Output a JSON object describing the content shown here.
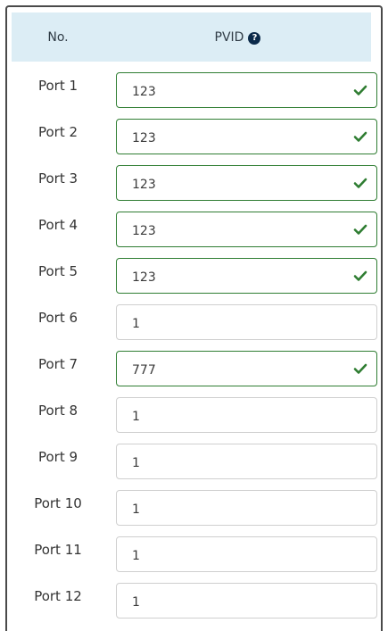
{
  "header": {
    "no_label": "No.",
    "pvid_label": "PVID"
  },
  "colors": {
    "valid_border": "#2f7d32",
    "check": "#2f7d32",
    "header_bg": "#dcedf5"
  },
  "ports": [
    {
      "label": "Port 1",
      "value": "123",
      "valid": true
    },
    {
      "label": "Port 2",
      "value": "123",
      "valid": true
    },
    {
      "label": "Port 3",
      "value": "123",
      "valid": true
    },
    {
      "label": "Port 4",
      "value": "123",
      "valid": true
    },
    {
      "label": "Port 5",
      "value": "123",
      "valid": true
    },
    {
      "label": "Port 6",
      "value": "1",
      "valid": false
    },
    {
      "label": "Port 7",
      "value": "777",
      "valid": true
    },
    {
      "label": "Port 8",
      "value": "1",
      "valid": false
    },
    {
      "label": "Port 9",
      "value": "1",
      "valid": false
    },
    {
      "label": "Port 10",
      "value": "1",
      "valid": false
    },
    {
      "label": "Port 11",
      "value": "1",
      "valid": false
    },
    {
      "label": "Port 12",
      "value": "1",
      "valid": false
    }
  ]
}
